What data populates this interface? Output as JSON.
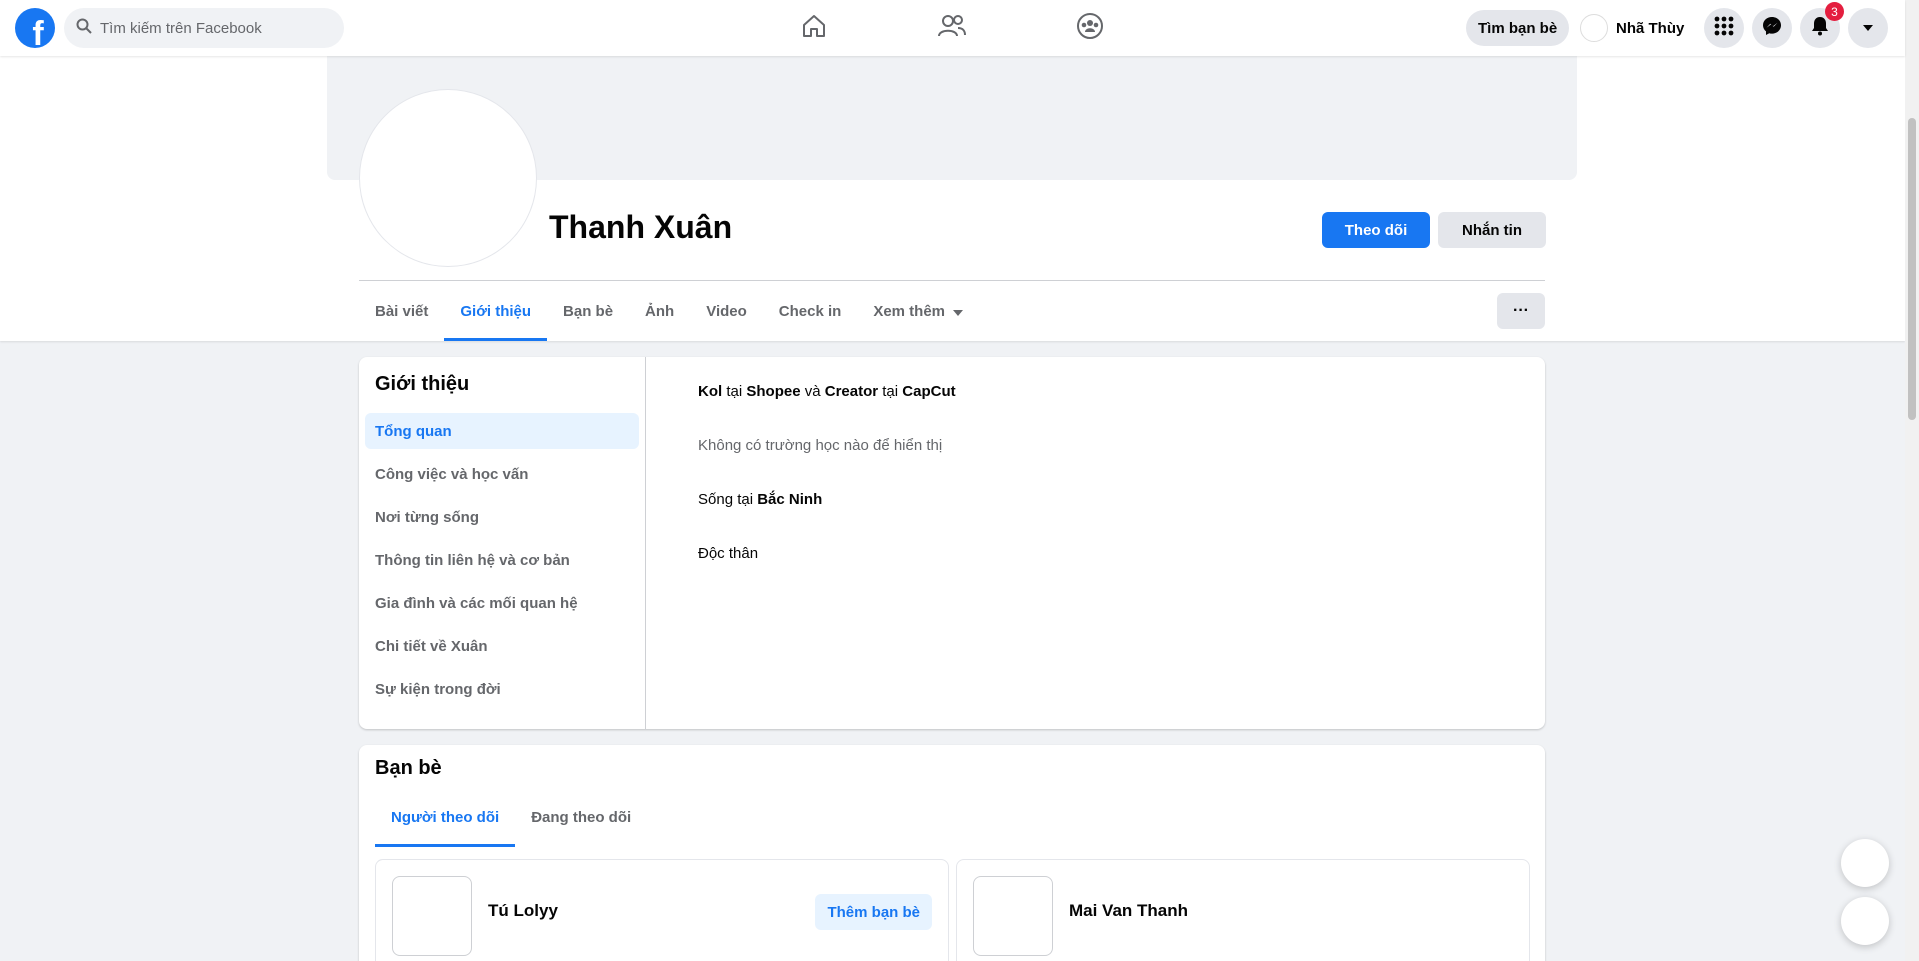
{
  "topbar": {
    "logo_letter": "f",
    "search_placeholder": "Tìm kiếm trên Facebook",
    "find_friends_label": "Tìm bạn bè",
    "user_name": "Nhã Thùy",
    "notification_count": "3"
  },
  "profile": {
    "name": "Thanh Xuân",
    "follow_label": "Theo dõi",
    "message_label": "Nhắn tin",
    "tabs": [
      "Bài viết",
      "Giới thiệu",
      "Bạn bè",
      "Ảnh",
      "Video",
      "Check in",
      "Xem thêm"
    ],
    "active_tab": "Giới thiệu",
    "more_label": "···"
  },
  "intro": {
    "title": "Giới thiệu",
    "menu": [
      "Tổng quan",
      "Công việc và học vấn",
      "Nơi từng sống",
      "Thông tin liên hệ và cơ bản",
      "Gia đình và các mối quan hệ",
      "Chi tiết về Xuân",
      "Sự kiện trong đời"
    ],
    "work": {
      "role1": "Kol",
      "at1": "tại",
      "company1": "Shopee",
      "and": "và",
      "role2": "Creator",
      "at2": "tại",
      "company2": "CapCut"
    },
    "school": "Không có trường học nào để hiển thị",
    "lives": {
      "prefix": "Sống tại",
      "place": "Bắc Ninh"
    },
    "relationship": "Độc thân"
  },
  "friends": {
    "title": "Bạn bè",
    "tabs": [
      "Người theo dõi",
      "Đang theo dõi"
    ],
    "items": [
      {
        "name": "Tú Lolyy",
        "action": "Thêm bạn bè"
      },
      {
        "name": "Mai Van Thanh"
      }
    ]
  },
  "colors": {
    "brand": "#1877f2",
    "badge": "#e41e3f"
  }
}
